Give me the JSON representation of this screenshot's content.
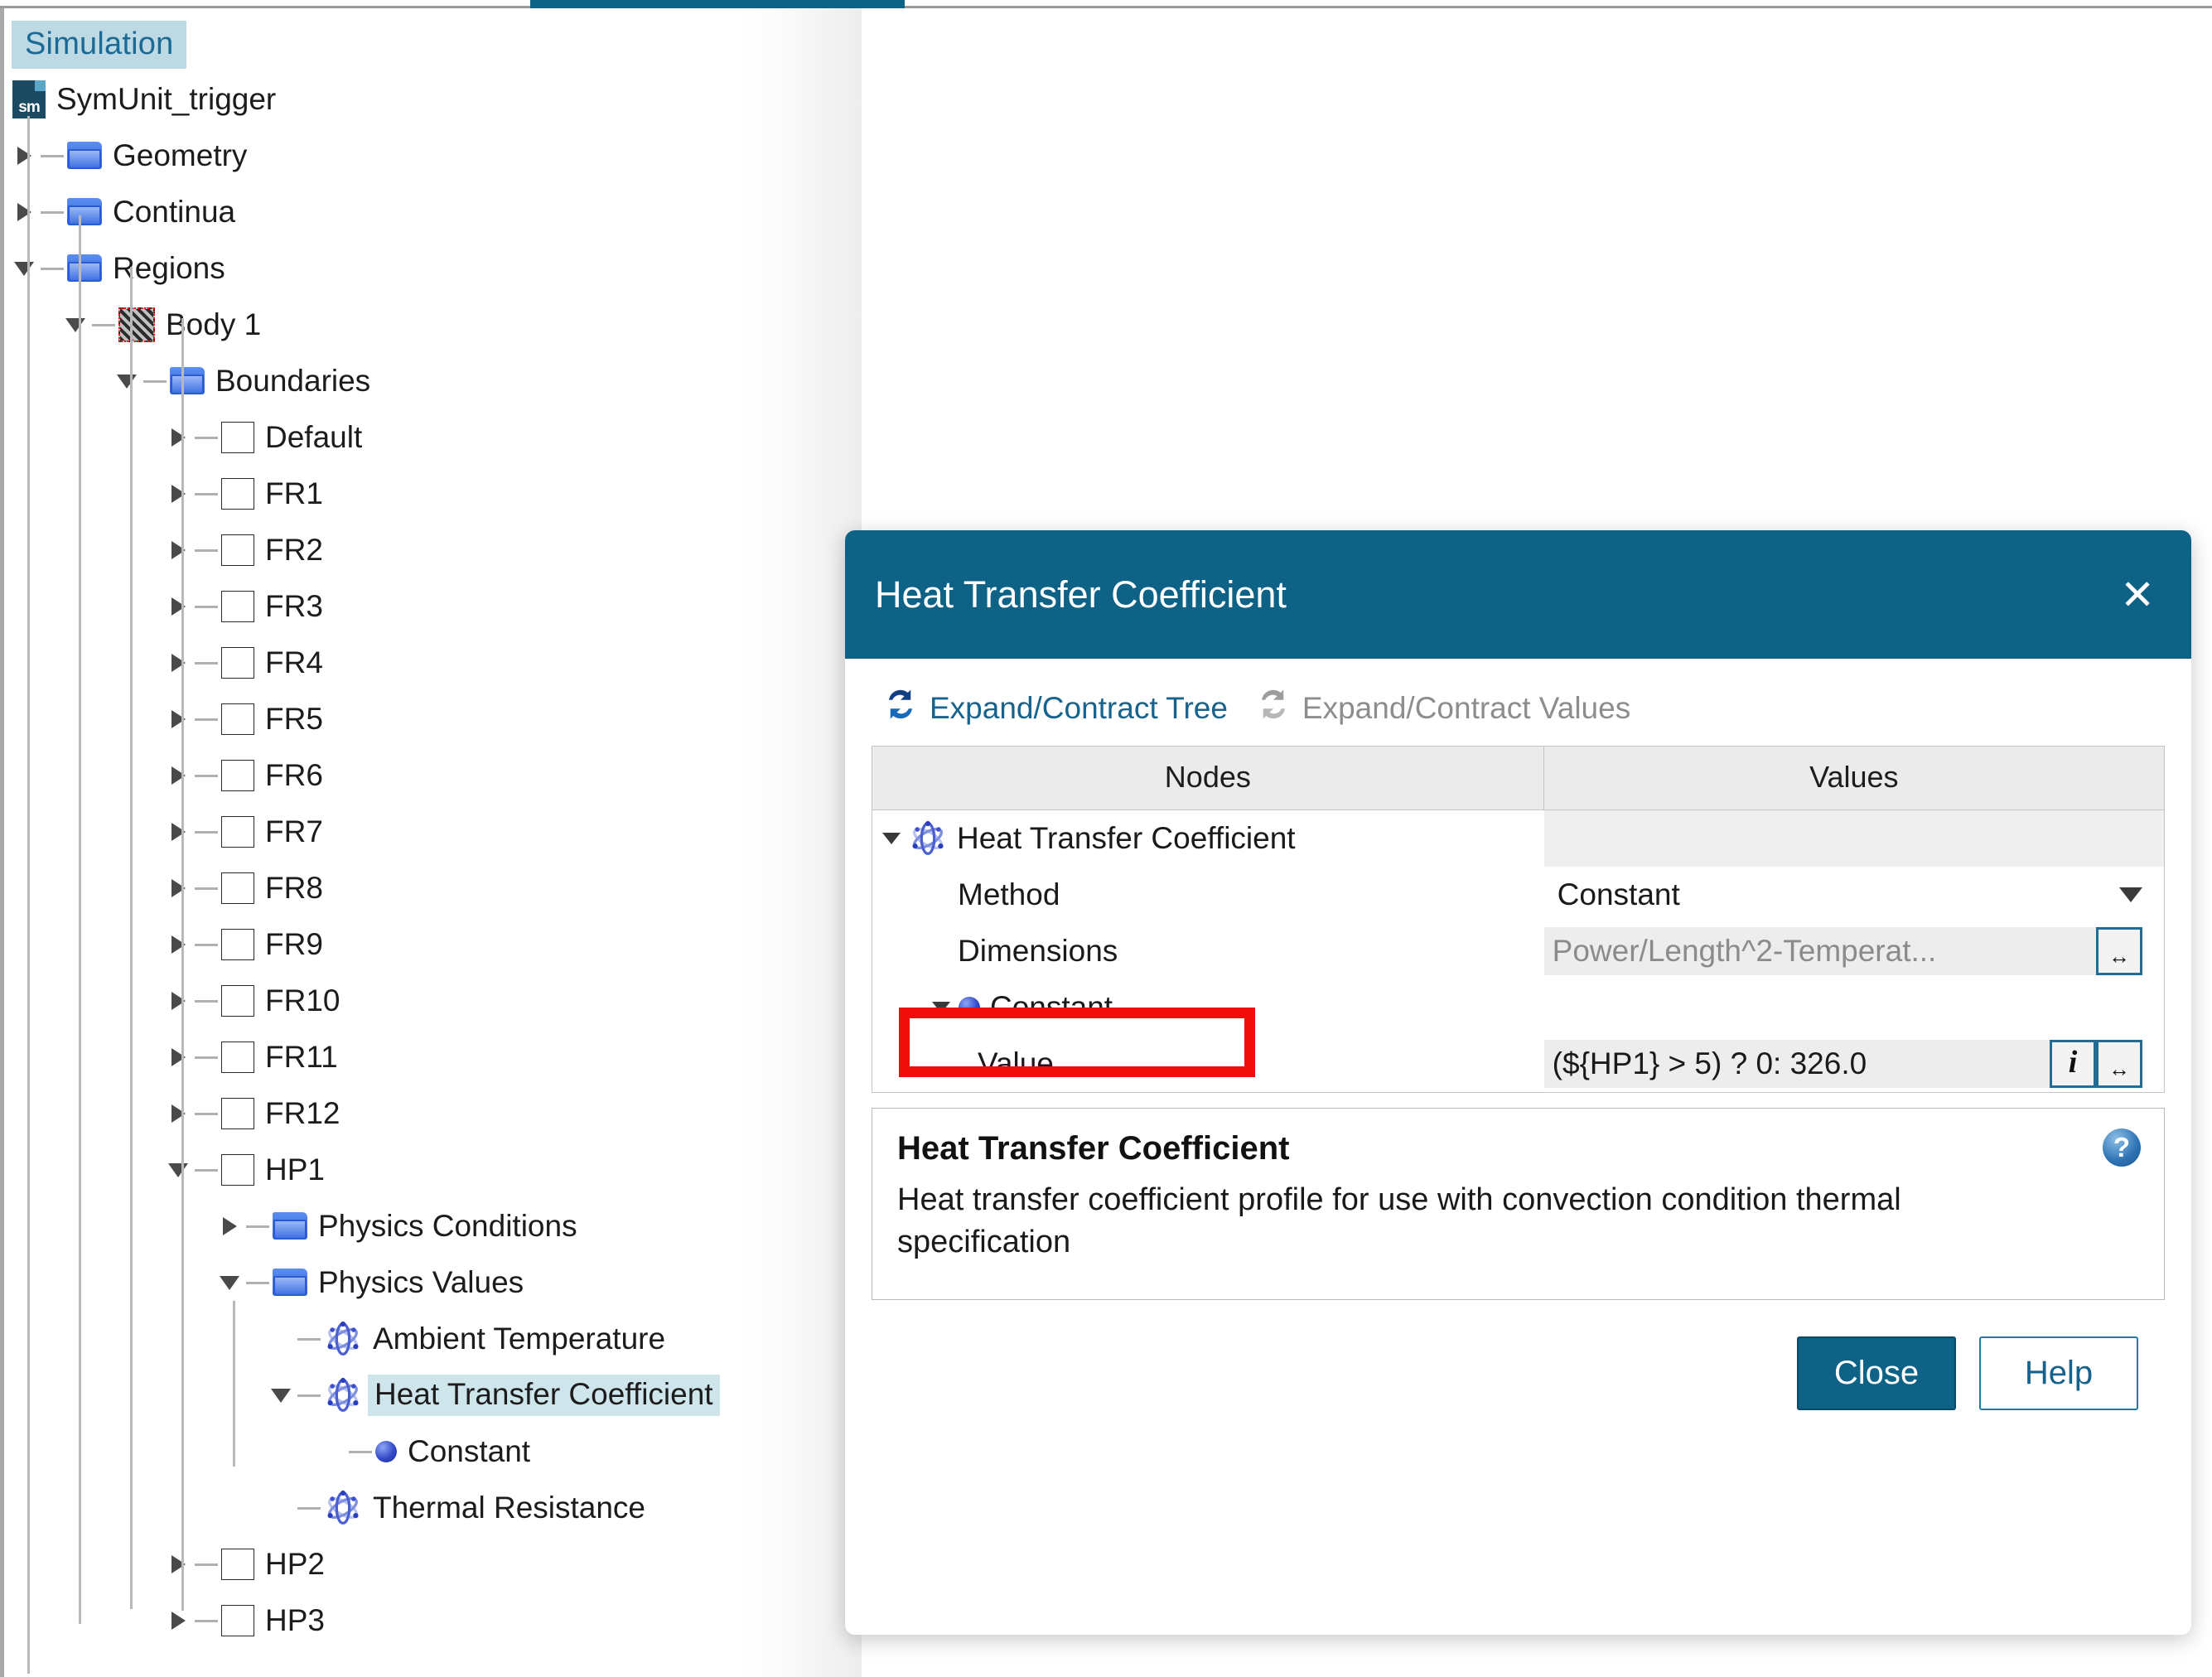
{
  "window": {
    "active_tab_label": "Simulation"
  },
  "tree": {
    "root_label": "SymUnit_trigger",
    "root_icon": "sim-file-icon",
    "items": [
      {
        "label": "Geometry",
        "depth": 1,
        "icon": "folder-icon",
        "expander": "right"
      },
      {
        "label": "Continua",
        "depth": 1,
        "icon": "folder-icon",
        "expander": "right"
      },
      {
        "label": "Regions",
        "depth": 1,
        "icon": "folder-icon",
        "expander": "down"
      },
      {
        "label": "Body 1",
        "depth": 2,
        "icon": "body-icon",
        "expander": "down"
      },
      {
        "label": "Boundaries",
        "depth": 3,
        "icon": "folder-icon",
        "expander": "down"
      },
      {
        "label": "Default",
        "depth": 4,
        "icon": "boundary-icon",
        "expander": "right"
      },
      {
        "label": "FR1",
        "depth": 4,
        "icon": "boundary-icon",
        "expander": "right"
      },
      {
        "label": "FR2",
        "depth": 4,
        "icon": "boundary-icon",
        "expander": "right"
      },
      {
        "label": "FR3",
        "depth": 4,
        "icon": "boundary-icon",
        "expander": "right"
      },
      {
        "label": "FR4",
        "depth": 4,
        "icon": "boundary-icon",
        "expander": "right"
      },
      {
        "label": "FR5",
        "depth": 4,
        "icon": "boundary-icon",
        "expander": "right"
      },
      {
        "label": "FR6",
        "depth": 4,
        "icon": "boundary-icon",
        "expander": "right"
      },
      {
        "label": "FR7",
        "depth": 4,
        "icon": "boundary-icon",
        "expander": "right"
      },
      {
        "label": "FR8",
        "depth": 4,
        "icon": "boundary-icon",
        "expander": "right"
      },
      {
        "label": "FR9",
        "depth": 4,
        "icon": "boundary-icon",
        "expander": "right"
      },
      {
        "label": "FR10",
        "depth": 4,
        "icon": "boundary-icon",
        "expander": "right"
      },
      {
        "label": "FR11",
        "depth": 4,
        "icon": "boundary-icon",
        "expander": "right"
      },
      {
        "label": "FR12",
        "depth": 4,
        "icon": "boundary-icon",
        "expander": "right"
      },
      {
        "label": "HP1",
        "depth": 4,
        "icon": "boundary-icon",
        "expander": "down"
      },
      {
        "label": "Physics Conditions",
        "depth": 5,
        "icon": "folder-icon",
        "expander": "right"
      },
      {
        "label": "Physics Values",
        "depth": 5,
        "icon": "folder-icon",
        "expander": "down"
      },
      {
        "label": "Ambient Temperature",
        "depth": 6,
        "icon": "atom-icon",
        "expander": "none"
      },
      {
        "label": "Heat Transfer Coefficient",
        "depth": 6,
        "icon": "atom-icon",
        "expander": "down",
        "selected": true
      },
      {
        "label": "Constant",
        "depth": 7,
        "icon": "dot-icon",
        "expander": "none"
      },
      {
        "label": "Thermal Resistance",
        "depth": 6,
        "icon": "atom-icon",
        "expander": "none"
      },
      {
        "label": "HP2",
        "depth": 4,
        "icon": "boundary-icon",
        "expander": "right"
      },
      {
        "label": "HP3",
        "depth": 4,
        "icon": "boundary-icon",
        "expander": "right"
      }
    ]
  },
  "dialog": {
    "title": "Heat Transfer Coefficient",
    "close_icon": "close-icon",
    "toolbar": {
      "expand_tree_label": "Expand/Contract Tree",
      "expand_values_label": "Expand/Contract Values",
      "expand_tree_icon": "refresh-icon",
      "expand_values_icon": "refresh-icon"
    },
    "table": {
      "columns": [
        "Nodes",
        "Values"
      ],
      "rows": [
        {
          "node": "Heat Transfer Coefficient",
          "value": "",
          "indent": 0,
          "expander": "down",
          "icon": "atom-icon",
          "value_style": "grey"
        },
        {
          "node": "Method",
          "value": "Constant",
          "indent": 1,
          "expander": "none",
          "icon": "none",
          "value_style": "dropdown"
        },
        {
          "node": "Dimensions",
          "value": "Power/Length^2-Temperat...",
          "indent": 1,
          "expander": "none",
          "icon": "none",
          "value_style": "readonly-with-button"
        },
        {
          "node": "Constant",
          "value": "",
          "indent": 1,
          "expander": "down",
          "icon": "dot-icon",
          "value_style": "blank"
        },
        {
          "node": "Value",
          "value": "(${HP1} > 5) ? 0: 326.0",
          "indent": 2,
          "expander": "none",
          "icon": "none",
          "value_style": "expr-with-buttons"
        }
      ],
      "info_button_icon": "info-icon",
      "ellipsis_button_icon": "expand-field-icon"
    },
    "description": {
      "title": "Heat Transfer Coefficient",
      "text": "Heat transfer coefficient profile for use with convection condition thermal specification",
      "help_icon": "help-icon",
      "help_glyph": "?"
    },
    "footer": {
      "close_label": "Close",
      "help_label": "Help"
    }
  },
  "annotation": {
    "highlight_color": "#f20d0d",
    "highlight_target": "Value field expression"
  },
  "colors": {
    "header_teal": "#0d6285",
    "selection_blue": "#cfe5ec",
    "tab_blue": "#bdd9e3",
    "link_blue": "#16638d",
    "disabled_grey": "#8d8d8d"
  }
}
